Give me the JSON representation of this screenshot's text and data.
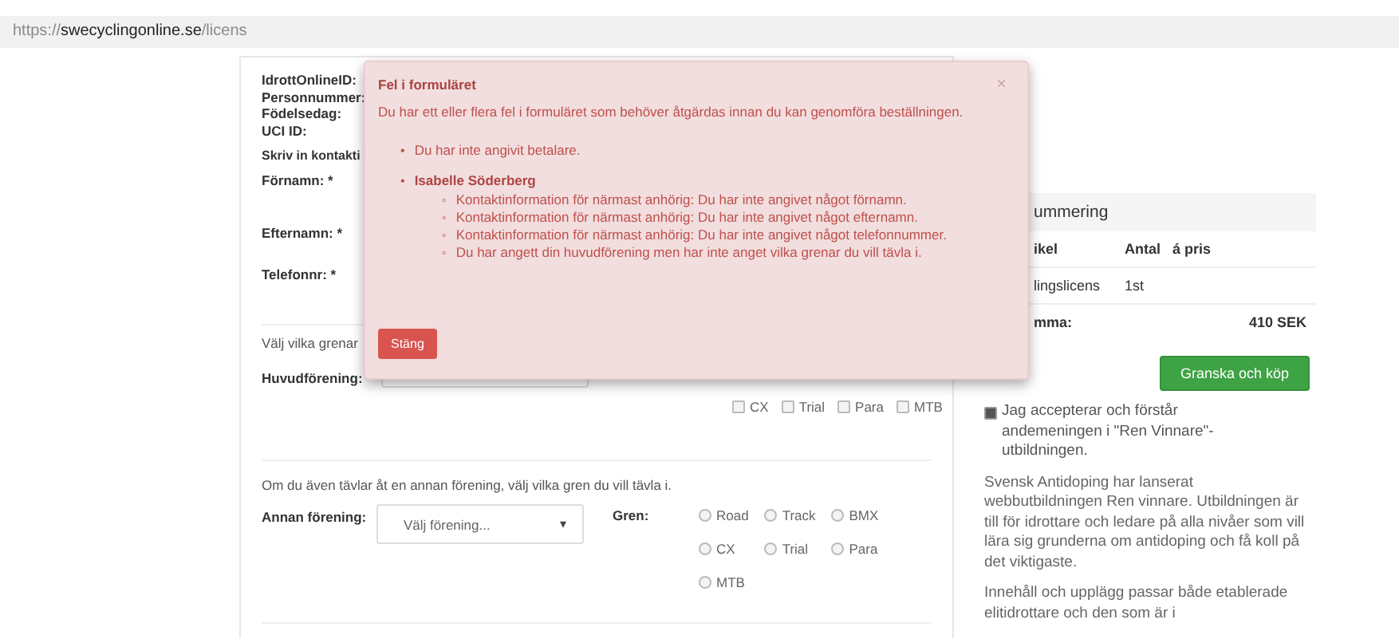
{
  "address_bar": {
    "url": [
      {
        "text": "https://",
        "kind": "dim"
      },
      {
        "text": "swecyclingonline.se",
        "kind": "host"
      },
      {
        "text": "/licens",
        "kind": "dim"
      }
    ]
  },
  "form": {
    "person_labels": [
      "IdrottOnlineID:",
      "Personnummer:",
      "Födelsedag:",
      "UCI ID:"
    ],
    "contact_prompt": "Skriv in kontakti",
    "contact_fields": [
      {
        "label": "Förnamn: *"
      },
      {
        "label": "Efternamn: *"
      },
      {
        "label": "Telefonnr: *"
      }
    ],
    "main_club": {
      "prompt": "Välj vilka grenar",
      "label": "Huvudförening:",
      "branches": [
        {
          "label": "CX",
          "checked": false
        },
        {
          "label": "Trial",
          "checked": false
        },
        {
          "label": "Para",
          "checked": false
        },
        {
          "label": "MTB",
          "checked": false
        }
      ]
    },
    "other_club": {
      "prompt": "Om du även tävlar åt en annan förening, välj vilka gren du vill tävla i.",
      "label": "Annan förening:",
      "select_text": "Välj förening...",
      "caret": "▾",
      "branch_label": "Gren:",
      "branches": [
        {
          "label": "Road",
          "selected": false
        },
        {
          "label": "Track",
          "selected": false
        },
        {
          "label": "BMX",
          "selected": false
        },
        {
          "label": "CX",
          "selected": false
        },
        {
          "label": "Trial",
          "selected": false
        },
        {
          "label": "Para",
          "selected": false
        },
        {
          "label": "MTB",
          "selected": false
        }
      ]
    }
  },
  "summary": {
    "title": "ummering",
    "columns": [
      "ikel",
      "Antal",
      "á pris"
    ],
    "rows": [
      {
        "cells": [
          "lingslicens",
          "1st"
        ]
      }
    ],
    "total": {
      "label": "mma:",
      "value": "410 SEK"
    },
    "buy_button": "Granska och köp",
    "accept": {
      "label": "Jag accepterar och förstår andemeningen i \"Ren Vinnare\"-utbildningen.",
      "checked": true
    },
    "paragraphs": [
      "Svensk Antidoping har lanserat webbutbildningen Ren vinnare. Utbildningen är till för idrottare och ledare på alla nivåer som vill lära sig grunderna om antidoping och få koll på det viktigaste.",
      "Innehåll och upplägg passar både etablerade elitidrottare och den som är i"
    ]
  },
  "modal": {
    "title": "Fel i formuläret",
    "close_icon": "×",
    "message": "Du har ett eller flera fel i formuläret som behöver åtgärdas innan du kan genomföra beställningen.",
    "errors": [
      {
        "marker": "•",
        "text": "Du har inte angivit betalare."
      },
      {
        "marker": "•",
        "text": "Isabelle Söderberg",
        "children": [
          {
            "marker": "◦",
            "text": "Kontaktinformation för närmast anhörig: Du har inte angivet något förnamn."
          },
          {
            "marker": "◦",
            "text": "Kontaktinformation för närmast anhörig: Du har inte angivet något efternamn."
          },
          {
            "marker": "◦",
            "text": "Kontaktinformation för närmast anhörig: Du har inte angivet något telefonnummer."
          },
          {
            "marker": "◦",
            "text": "Du har angett din huvudförening men har inte anget vilka grenar du vill tävla i."
          }
        ]
      }
    ],
    "close_button": "Stäng"
  }
}
